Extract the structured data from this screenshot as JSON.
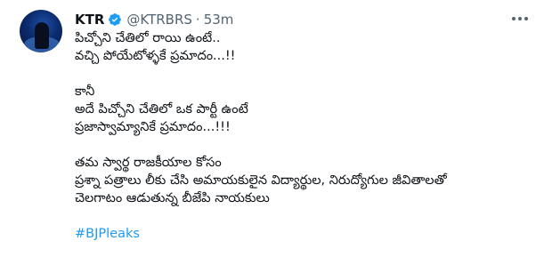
{
  "author": {
    "name": "KTR",
    "handle": "@KTRBRS",
    "separator": "·",
    "time": "53m"
  },
  "colors": {
    "verified": "#1d9bf0",
    "hashtag": "#1d9bf0",
    "secondary_text": "#536471"
  },
  "icons": {
    "verified": "verified-badge-icon",
    "more": "more-options-icon"
  },
  "tweet": {
    "paragraphs": [
      {
        "lines": [
          "పిచ్చోని చేతిలో రాయి ఉంటే..",
          "వచ్చి పోయేటోళ్ళకే ప్రమాదం...!!"
        ]
      },
      {
        "lines": [
          "కానీ",
          "అదే పిచ్చోని చేతిలో ఒక పార్టీ ఉంటే",
          "ప్రజాస్వామ్యానికే ప్రమాదం...!!!"
        ]
      },
      {
        "lines": [
          "తమ స్వార్థ రాజకీయాల కోసం",
          "ప్రశ్నా పత్రాలు లీకు చేసి అమాయకులైన విద్యార్థుల, నిరుద్యోగుల జీవితాలతో",
          "చెలగాటం ఆడుతున్న బీజేపి నాయకులు"
        ]
      }
    ],
    "hashtag": "#BJPleaks"
  }
}
